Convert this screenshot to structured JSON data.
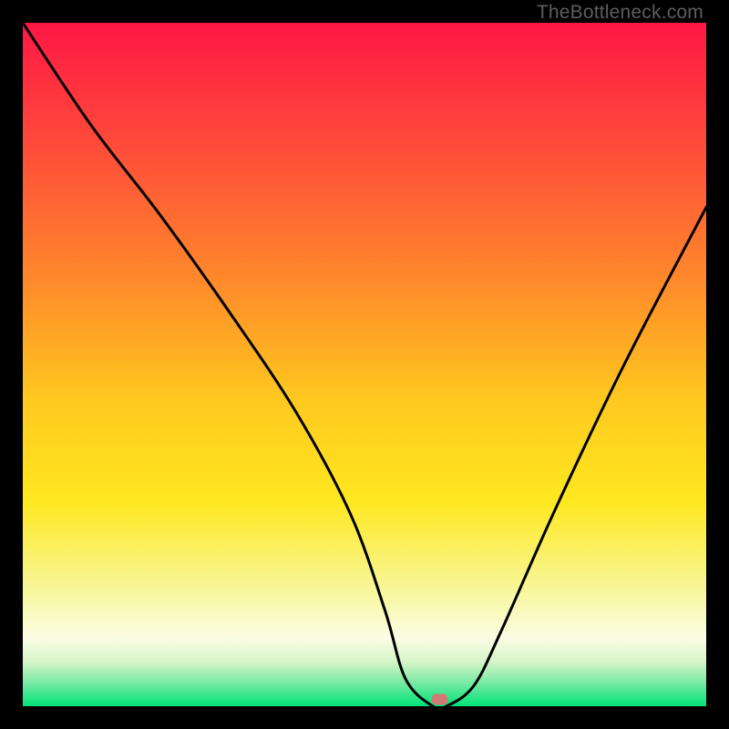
{
  "watermark": "TheBottleneck.com",
  "chart_data": {
    "type": "line",
    "title": "",
    "xlabel": "",
    "ylabel": "",
    "xlim": [
      0,
      100
    ],
    "ylim": [
      0,
      100
    ],
    "grid": false,
    "legend": false,
    "series": [
      {
        "name": "bottleneck-curve",
        "x": [
          0,
          10,
          20,
          30,
          40,
          48,
          53,
          56,
          60,
          62,
          66,
          70,
          78,
          88,
          100
        ],
        "values": [
          100,
          85,
          72,
          58,
          43,
          28,
          14,
          4,
          0,
          0,
          3,
          11,
          29,
          50,
          73
        ]
      }
    ],
    "marker": {
      "x": 61,
      "y": 1,
      "color": "#cf7b74"
    },
    "gradient_stops": [
      {
        "offset": 0.0,
        "color": "#ff1744"
      },
      {
        "offset": 0.18,
        "color": "#ff4b3a"
      },
      {
        "offset": 0.38,
        "color": "#ff8a2a"
      },
      {
        "offset": 0.55,
        "color": "#ffc81f"
      },
      {
        "offset": 0.7,
        "color": "#ffe81f"
      },
      {
        "offset": 0.83,
        "color": "#f7f79a"
      },
      {
        "offset": 0.9,
        "color": "#fbfde5"
      },
      {
        "offset": 0.935,
        "color": "#d6f5c8"
      },
      {
        "offset": 0.965,
        "color": "#7be9a4"
      },
      {
        "offset": 1.0,
        "color": "#00e37a"
      }
    ]
  }
}
